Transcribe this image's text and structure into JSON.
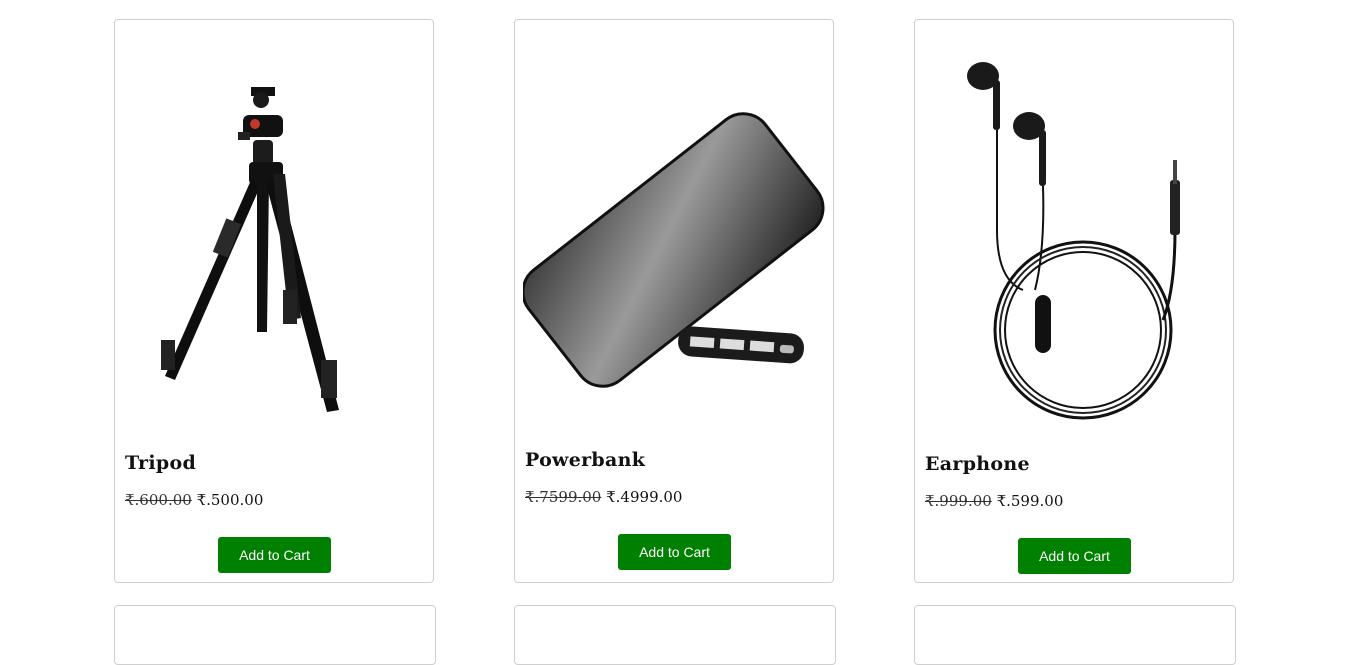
{
  "products": [
    {
      "name": "Tripod",
      "old_price": "₹.600.00",
      "new_price": "₹.500.00",
      "button_label": "Add to Cart",
      "icon": "tripod-image"
    },
    {
      "name": "Powerbank",
      "old_price": "₹.7599.00",
      "new_price": "₹.4999.00",
      "button_label": "Add to Cart",
      "icon": "powerbank-image"
    },
    {
      "name": "Earphone",
      "old_price": "₹.999.00",
      "new_price": "₹.599.00",
      "button_label": "Add to Cart",
      "icon": "earphone-image"
    }
  ],
  "colors": {
    "button_bg": "#008000",
    "button_text": "#ffffff",
    "card_border": "#cfcfcf"
  }
}
